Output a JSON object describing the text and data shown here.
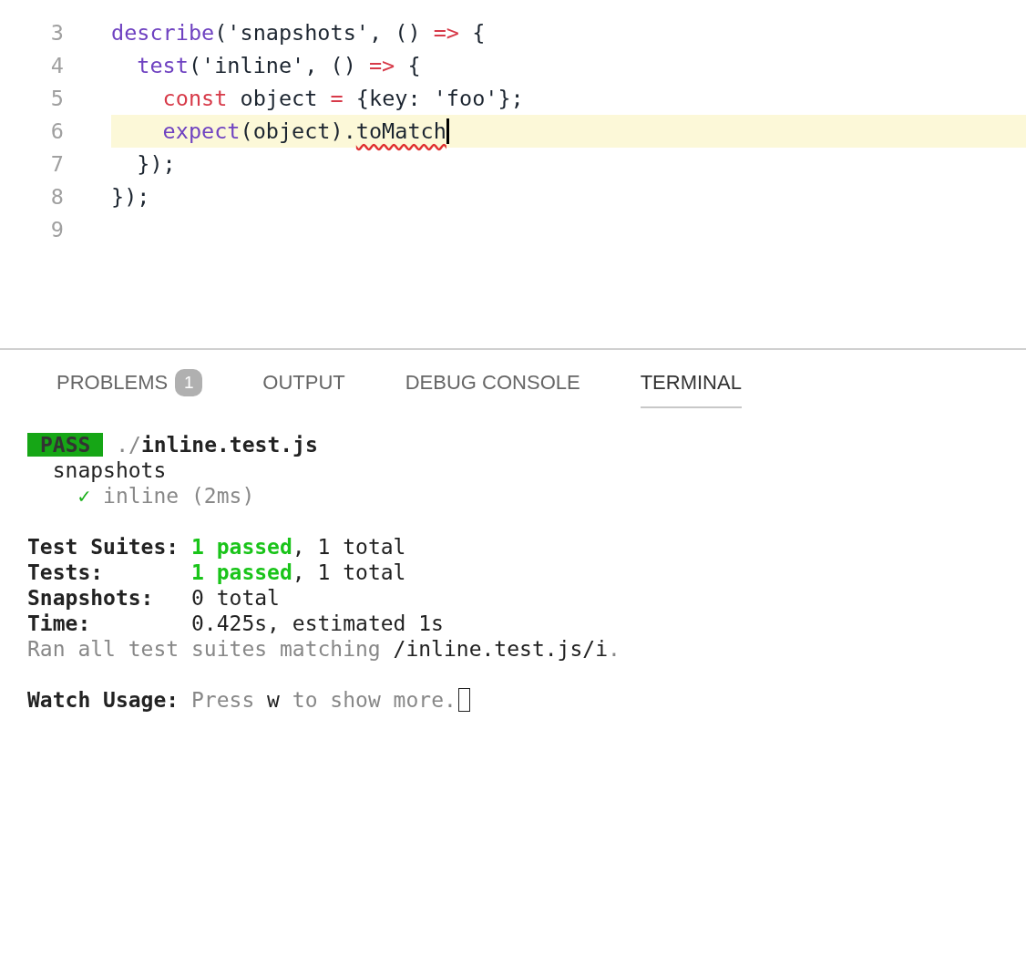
{
  "editor": {
    "lines": [
      {
        "number": "3",
        "current": false,
        "tokens": [
          {
            "text": "describe",
            "kind": "func"
          },
          {
            "text": "('snapshots', () ",
            "kind": "plain"
          },
          {
            "text": "=>",
            "kind": "keyword"
          },
          {
            "text": " {",
            "kind": "plain"
          }
        ]
      },
      {
        "number": "4",
        "current": false,
        "tokens": [
          {
            "text": "  test",
            "kind": "func"
          },
          {
            "text": "('inline', () ",
            "kind": "plain"
          },
          {
            "text": "=>",
            "kind": "keyword"
          },
          {
            "text": " {",
            "kind": "plain"
          }
        ]
      },
      {
        "number": "5",
        "current": false,
        "tokens": [
          {
            "text": "    const",
            "kind": "keyword"
          },
          {
            "text": " object ",
            "kind": "plain"
          },
          {
            "text": "=",
            "kind": "keyword"
          },
          {
            "text": " {key: 'foo'};",
            "kind": "plain"
          }
        ]
      },
      {
        "number": "6",
        "current": true,
        "tokens": [
          {
            "text": "    expect",
            "kind": "func"
          },
          {
            "text": "(object).",
            "kind": "plain"
          },
          {
            "text": "toMatch",
            "kind": "error"
          }
        ]
      },
      {
        "number": "7",
        "current": false,
        "tokens": [
          {
            "text": "  });",
            "kind": "plain"
          }
        ]
      },
      {
        "number": "8",
        "current": false,
        "tokens": [
          {
            "text": "});",
            "kind": "plain"
          }
        ]
      },
      {
        "number": "9",
        "current": false
      }
    ]
  },
  "panel": {
    "tabs": [
      {
        "label": "PROBLEMS",
        "badge": "1",
        "selected": false
      },
      {
        "label": "OUTPUT",
        "selected": false
      },
      {
        "label": "DEBUG CONSOLE",
        "selected": false
      },
      {
        "label": "TERMINAL",
        "selected": true
      }
    ]
  },
  "terminal": {
    "blocks": [
      [
        {
          "segments": [
            {
              "text": "PASS",
              "kind": "badge"
            },
            {
              "text": " ./",
              "kind": "dim"
            },
            {
              "text": "inline.test.js",
              "kind": "bold"
            }
          ]
        },
        {
          "segments": [
            {
              "text": "  snapshots",
              "kind": "plain"
            }
          ]
        },
        {
          "segments": [
            {
              "text": "    ✓",
              "kind": "check"
            },
            {
              "text": " inline (2ms)",
              "kind": "dim"
            }
          ]
        }
      ],
      [
        {
          "segments": [
            {
              "text": "Test Suites: ",
              "kind": "bold"
            },
            {
              "text": "1 passed",
              "kind": "success"
            },
            {
              "text": ", 1 total",
              "kind": "plain"
            }
          ]
        },
        {
          "segments": [
            {
              "text": "Tests:       ",
              "kind": "bold"
            },
            {
              "text": "1 passed",
              "kind": "success"
            },
            {
              "text": ", 1 total",
              "kind": "plain"
            }
          ]
        },
        {
          "segments": [
            {
              "text": "Snapshots:   ",
              "kind": "bold"
            },
            {
              "text": "0 total",
              "kind": "plain"
            }
          ]
        },
        {
          "segments": [
            {
              "text": "Time:        ",
              "kind": "bold"
            },
            {
              "text": "0.425s, estimated 1s",
              "kind": "plain"
            }
          ]
        },
        {
          "segments": [
            {
              "text": "Ran all test suites matching ",
              "kind": "dim"
            },
            {
              "text": "/inline.test.js/i",
              "kind": "plain"
            },
            {
              "text": ".",
              "kind": "dim"
            }
          ]
        }
      ],
      [
        {
          "cursor": true,
          "segments": [
            {
              "text": "Watch Usage: ",
              "kind": "bold"
            },
            {
              "text": "Press ",
              "kind": "dim"
            },
            {
              "text": "w",
              "kind": "plain"
            },
            {
              "text": " to show more.",
              "kind": "dim"
            }
          ]
        }
      ]
    ]
  }
}
